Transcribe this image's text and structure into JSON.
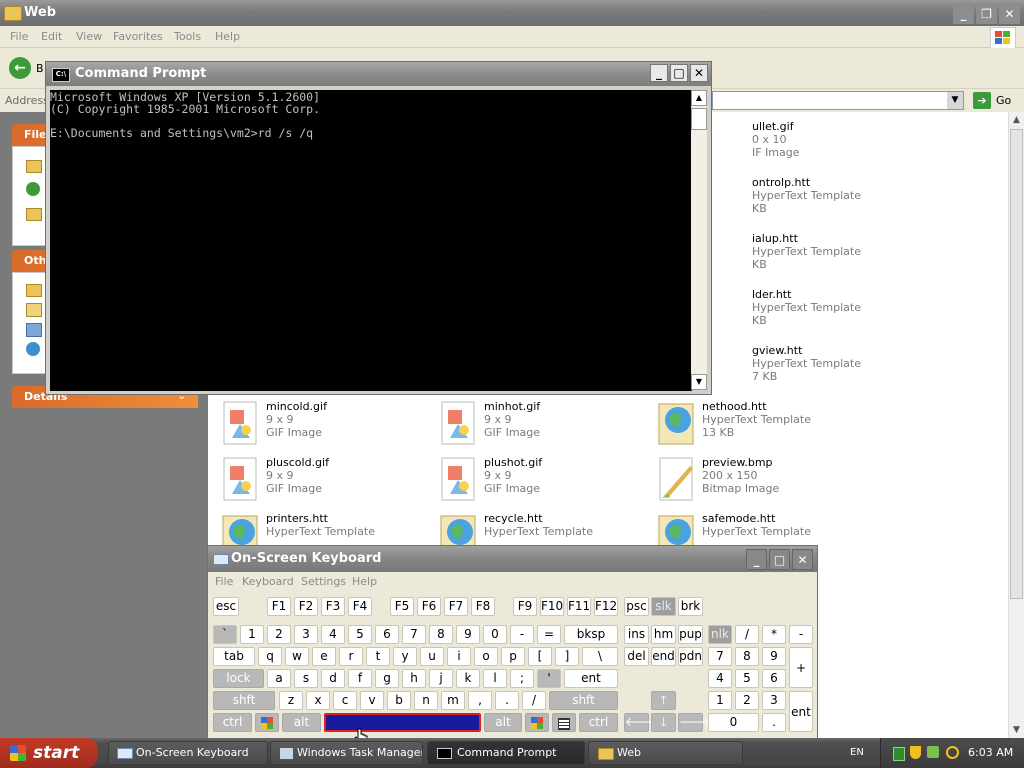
{
  "explorer": {
    "title": "Web",
    "menu": [
      "File",
      "Edit",
      "View",
      "Favorites",
      "Tools",
      "Help"
    ],
    "back_label": "B",
    "address_label": "Address",
    "go_label": "Go",
    "tasks": [
      {
        "head": "File"
      },
      {
        "head": "Oth"
      },
      {
        "head": "Details"
      }
    ],
    "files": [
      {
        "name": "ullet.gif",
        "sub": "0 x 10",
        "sub2": "IF Image"
      },
      {
        "name": "ontrolp.htt",
        "sub": "HyperText Template",
        "sub2": "KB"
      },
      {
        "name": "ialup.htt",
        "sub": "HyperText Template",
        "sub2": "KB"
      },
      {
        "name": "lder.htt",
        "sub": "HyperText Template",
        "sub2": "KB"
      },
      {
        "name": "gview.htt",
        "sub": "HyperText Template",
        "sub2": "7 KB"
      },
      {
        "name": "mincold.gif",
        "sub": "9 x 9",
        "sub2": "GIF Image"
      },
      {
        "name": "minhot.gif",
        "sub": "9 x 9",
        "sub2": "GIF Image"
      },
      {
        "name": "nethood.htt",
        "sub": "HyperText Template",
        "sub2": "13 KB"
      },
      {
        "name": "pluscold.gif",
        "sub": "9 x 9",
        "sub2": "GIF Image"
      },
      {
        "name": "plushot.gif",
        "sub": "9 x 9",
        "sub2": "GIF Image"
      },
      {
        "name": "preview.bmp",
        "sub": "200 x 150",
        "sub2": "Bitmap Image"
      },
      {
        "name": "printers.htt",
        "sub": "HyperText Template",
        "sub2": ""
      },
      {
        "name": "recycle.htt",
        "sub": "HyperText Template",
        "sub2": ""
      },
      {
        "name": "safemode.htt",
        "sub": "HyperText Template",
        "sub2": ""
      }
    ]
  },
  "cmd": {
    "title": "Command Prompt",
    "lines": [
      "Microsoft Windows XP [Version 5.1.2600]",
      "(C) Copyright 1985-2001 Microsoft Corp.",
      "",
      "E:\\Documents and Settings\\vm2>rd /s /q"
    ]
  },
  "osk": {
    "title": "On-Screen Keyboard",
    "menu": [
      "File",
      "Keyboard",
      "Settings",
      "Help"
    ],
    "keys": {
      "esc": "esc",
      "f1": "F1",
      "f2": "F2",
      "f3": "F3",
      "f4": "F4",
      "f5": "F5",
      "f6": "F6",
      "f7": "F7",
      "f8": "F8",
      "f9": "F9",
      "f10": "F10",
      "f11": "F11",
      "f12": "F12",
      "psc": "psc",
      "slk": "slk",
      "brk": "brk",
      "grave": "`",
      "d1": "1",
      "d2": "2",
      "d3": "3",
      "d4": "4",
      "d5": "5",
      "d6": "6",
      "d7": "7",
      "d8": "8",
      "d9": "9",
      "d0": "0",
      "minus": "-",
      "equals": "=",
      "bksp": "bksp",
      "ins": "ins",
      "hm": "hm",
      "pup": "pup",
      "nlk": "nlk",
      "slash_np": "/",
      "star_np": "*",
      "minus_np": "-",
      "tab": "tab",
      "q": "q",
      "w": "w",
      "e": "e",
      "r": "r",
      "t": "t",
      "y": "y",
      "u": "u",
      "i": "i",
      "o": "o",
      "p": "p",
      "lbracket": "[",
      "rbracket": "]",
      "backslash": "\\",
      "del": "del",
      "end": "end",
      "pdn": "pdn",
      "np7": "7",
      "np8": "8",
      "np9": "9",
      "plus_np": "+",
      "lock": "lock",
      "a": "a",
      "s": "s",
      "d": "d",
      "f": "f",
      "g": "g",
      "h": "h",
      "j": "j",
      "k": "k",
      "l": "l",
      "semicolon": ";",
      "quote": "'",
      "ent": "ent",
      "np4": "4",
      "np5": "5",
      "np6": "6",
      "shft": "shft",
      "z": "z",
      "x": "x",
      "c": "c",
      "v": "v",
      "b": "b",
      "n": "n",
      "m": "m",
      "comma": ",",
      "period": ".",
      "slash": "/",
      "shft_r": "shft",
      "np1": "1",
      "np2": "2",
      "np3": "3",
      "ent_np": "ent",
      "ctrl": "ctrl",
      "alt": "alt",
      "alt_r": "alt",
      "ctrl_r": "ctrl",
      "np0": "0",
      "npdot": "."
    }
  },
  "taskbar": {
    "start": "start",
    "items": [
      "On-Screen Keyboard",
      "Windows Task Manager",
      "Command Prompt",
      "Web"
    ],
    "lang": "EN",
    "clock": "6:03 AM"
  }
}
